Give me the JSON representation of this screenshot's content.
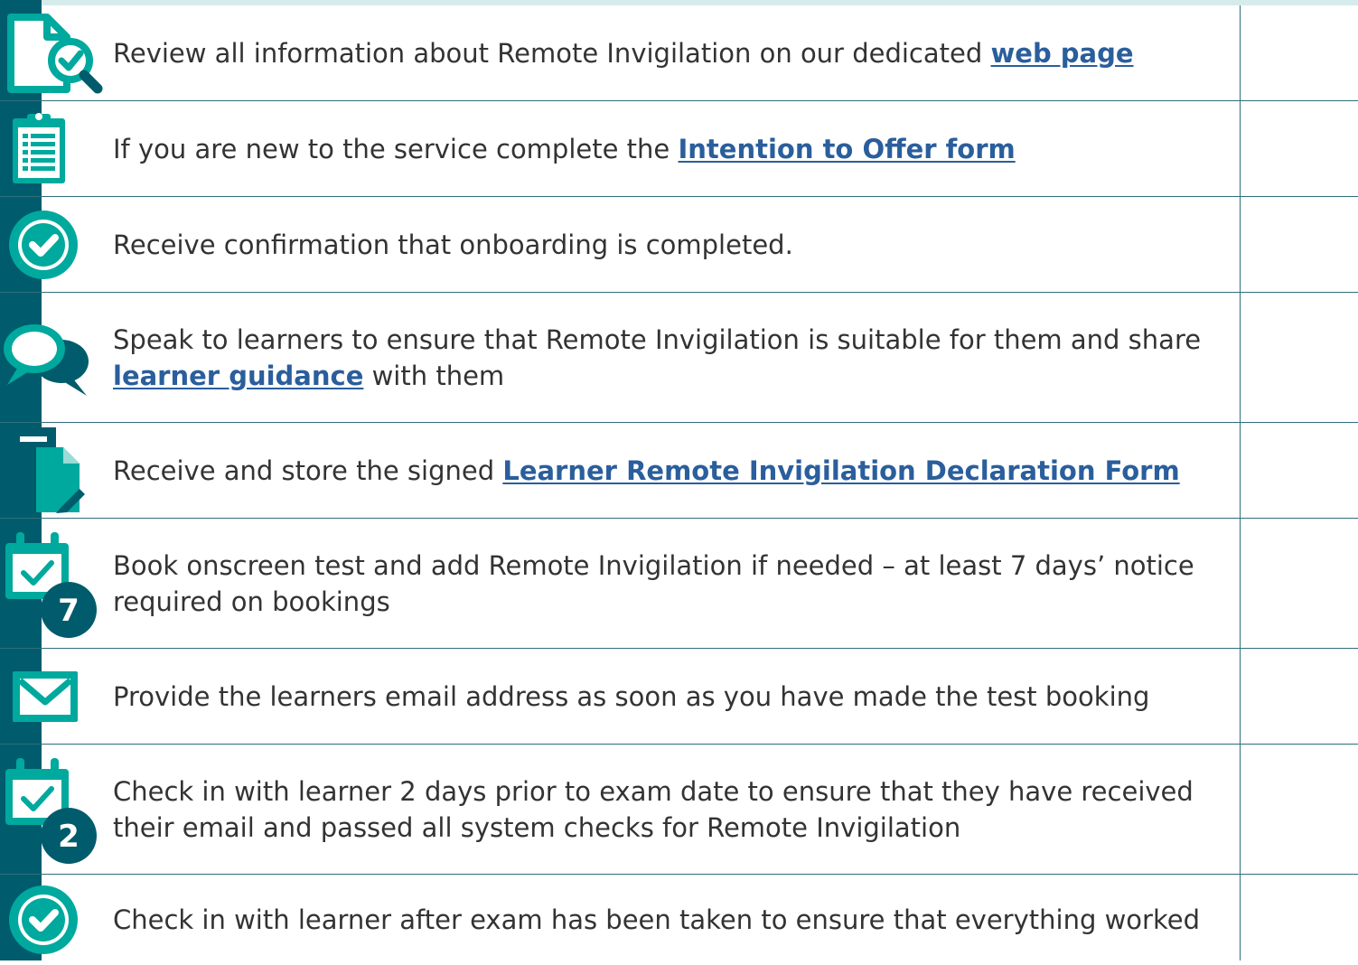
{
  "colors": {
    "teal": "#00a99d",
    "dark_teal": "#005c6c",
    "link": "#2a5e9c",
    "text": "#333333",
    "line": "#2f6f7d"
  },
  "steps": [
    {
      "icon": "document-search-icon",
      "text": "Review all information about Remote Invigilation on our dedicated ",
      "link": "web page",
      "after": ""
    },
    {
      "icon": "clipboard-list-icon",
      "text": "If you are new to the service complete the ",
      "link": "Intention to Offer form",
      "after": ""
    },
    {
      "icon": "check-circle-icon",
      "text": "Receive confirmation that onboarding is completed.",
      "link": "",
      "after": ""
    },
    {
      "icon": "chat-bubbles-icon",
      "text": "Speak to learners to ensure that Remote Invigilation is suitable for them and share ",
      "link": "learner guidance",
      "after": " with them"
    },
    {
      "icon": "document-sign-icon",
      "text": "Receive and store the signed ",
      "link": "Learner Remote Invigilation Declaration Form",
      "after": ""
    },
    {
      "icon": "calendar-7-icon",
      "badge": "7",
      "text": "Book onscreen test and add Remote Invigilation if needed – at least 7 days’ notice required on bookings",
      "link": "",
      "after": ""
    },
    {
      "icon": "envelope-icon",
      "text": "Provide the learners email address as soon as you have made the test booking",
      "link": "",
      "after": ""
    },
    {
      "icon": "calendar-2-icon",
      "badge": "2",
      "text": "Check in with learner 2 days prior to exam date to ensure that they have received their email and passed all system checks for Remote Invigilation",
      "link": "",
      "after": ""
    },
    {
      "icon": "check-circle-icon",
      "text": "Check in with learner after exam has been taken to ensure that everything worked",
      "link": "",
      "after": ""
    }
  ]
}
